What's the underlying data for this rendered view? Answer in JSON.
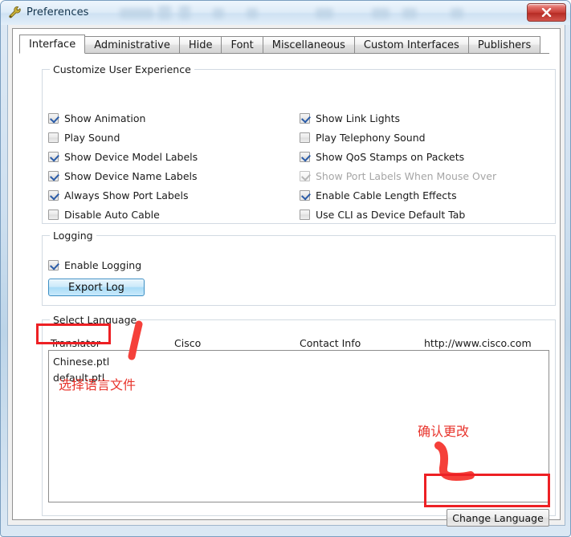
{
  "window": {
    "title": "Preferences",
    "icon": "wrench-tools-icon",
    "close_label": "x",
    "accent_red": "#ed2024",
    "titlebar_blue": "#cfe2f3"
  },
  "tabs": [
    {
      "label": "Interface",
      "active": true
    },
    {
      "label": "Administrative",
      "active": false
    },
    {
      "label": "Hide",
      "active": false
    },
    {
      "label": "Font",
      "active": false
    },
    {
      "label": "Miscellaneous",
      "active": false
    },
    {
      "label": "Custom Interfaces",
      "active": false
    },
    {
      "label": "Publishers",
      "active": false
    }
  ],
  "customize_group": {
    "title": "Customize User Experience",
    "left_column": [
      {
        "label": "Show Animation",
        "checked": true,
        "disabled": false
      },
      {
        "label": "Play Sound",
        "checked": false,
        "disabled": false
      },
      {
        "label": "Show Device Model Labels",
        "checked": true,
        "disabled": false
      },
      {
        "label": "Show Device Name Labels",
        "checked": true,
        "disabled": false
      },
      {
        "label": "Always Show Port Labels",
        "checked": true,
        "disabled": false
      },
      {
        "label": "Disable Auto Cable",
        "checked": false,
        "disabled": false
      }
    ],
    "right_column": [
      {
        "label": "Show Link Lights",
        "checked": true,
        "disabled": false
      },
      {
        "label": "Play Telephony Sound",
        "checked": false,
        "disabled": false
      },
      {
        "label": "Show QoS Stamps on Packets",
        "checked": true,
        "disabled": false
      },
      {
        "label": "Show Port Labels When Mouse Over",
        "checked": true,
        "disabled": true
      },
      {
        "label": "Enable Cable Length Effects",
        "checked": true,
        "disabled": false
      },
      {
        "label": "Use CLI as Device Default Tab",
        "checked": false,
        "disabled": false
      }
    ]
  },
  "logging_group": {
    "title": "Logging",
    "enable_logging": {
      "label": "Enable Logging",
      "checked": true
    },
    "export_log_label": "Export Log"
  },
  "language_group": {
    "title": "Select Language",
    "columns": [
      "Translator",
      "Cisco",
      "Contact Info",
      "http://www.cisco.com"
    ],
    "items": [
      {
        "label": "Chinese.ptl",
        "selected": true
      },
      {
        "label": "default.ptl",
        "selected": false
      }
    ],
    "change_language_label": "Change Language"
  },
  "annotations": {
    "select_file_note": "选择语言文件",
    "confirm_change_note": "确认更改"
  }
}
